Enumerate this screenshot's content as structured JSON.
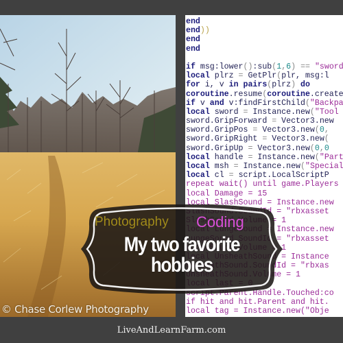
{
  "photo": {
    "subject": "dry golden grass field with bare winter trees under pale sky",
    "credit": "© Chase Corlew Photography"
  },
  "code": {
    "lines": [
      [
        [
          "k",
          "end"
        ]
      ],
      [
        [
          "k",
          "end"
        ],
        [
          "p",
          "))"
        ]
      ],
      [
        [
          "k",
          "end"
        ]
      ],
      [
        [
          "k",
          "end"
        ]
      ],
      [],
      [
        [
          "k",
          "if"
        ],
        [
          "i",
          " msg:lower"
        ],
        [
          "o",
          "()"
        ],
        [
          "i",
          ":sub"
        ],
        [
          "o",
          "("
        ],
        [
          "n",
          "1"
        ],
        [
          "o",
          ","
        ],
        [
          "n",
          "6"
        ],
        [
          "o",
          ")"
        ],
        [
          "o",
          " == "
        ],
        [
          "s",
          "\"sword"
        ]
      ],
      [
        [
          "k",
          "local"
        ],
        [
          "i",
          " plrz "
        ],
        [
          "o",
          "="
        ],
        [
          "i",
          " GetPlr"
        ],
        [
          "o",
          "("
        ],
        [
          "i",
          "plr, msg:l"
        ]
      ],
      [
        [
          "k",
          "for"
        ],
        [
          "i",
          " i, v "
        ],
        [
          "k",
          "in"
        ],
        [
          "k",
          " pairs"
        ],
        [
          "o",
          "("
        ],
        [
          "i",
          "plrz"
        ],
        [
          "o",
          ")"
        ],
        [
          "k",
          " do"
        ]
      ],
      [
        [
          "k",
          "coroutine"
        ],
        [
          "i",
          ".resume"
        ],
        [
          "o",
          "("
        ],
        [
          "k",
          "coroutine"
        ],
        [
          "i",
          ".create"
        ]
      ],
      [
        [
          "k",
          "if"
        ],
        [
          "i",
          " v "
        ],
        [
          "k",
          "and"
        ],
        [
          "i",
          " v:findFirstChild"
        ],
        [
          "o",
          "("
        ],
        [
          "s",
          "\"Backpack"
        ]
      ],
      [
        [
          "k",
          "local"
        ],
        [
          "i",
          " sword "
        ],
        [
          "o",
          "="
        ],
        [
          "i",
          " Instance.new"
        ],
        [
          "o",
          "("
        ],
        [
          "s",
          "\"Tool"
        ]
      ],
      [
        [
          "i",
          "sword.GripForward "
        ],
        [
          "o",
          "="
        ],
        [
          "i",
          " Vector3.new"
        ]
      ],
      [
        [
          "i",
          "sword.GripPos "
        ],
        [
          "o",
          "="
        ],
        [
          "i",
          " Vector3.new"
        ],
        [
          "o",
          "("
        ],
        [
          "n",
          "0"
        ],
        [
          "o",
          ","
        ]
      ],
      [
        [
          "i",
          "sword.GripRight "
        ],
        [
          "o",
          "="
        ],
        [
          "i",
          " Vector3.new"
        ],
        [
          "o",
          "("
        ]
      ],
      [
        [
          "i",
          "sword.GripUp "
        ],
        [
          "o",
          "="
        ],
        [
          "i",
          " Vector3.new"
        ],
        [
          "o",
          "("
        ],
        [
          "n",
          "0"
        ],
        [
          "o",
          ","
        ],
        [
          "n",
          "0"
        ]
      ],
      [
        [
          "k",
          "local"
        ],
        [
          "i",
          " handle "
        ],
        [
          "o",
          "="
        ],
        [
          "i",
          " Instance.new"
        ],
        [
          "o",
          "("
        ],
        [
          "s",
          "\"Part"
        ]
      ],
      [
        [
          "k",
          "local"
        ],
        [
          "i",
          " msh "
        ],
        [
          "o",
          "="
        ],
        [
          "i",
          " Instance.new"
        ],
        [
          "o",
          "("
        ],
        [
          "s",
          "\"SpecialMesh"
        ]
      ],
      [
        [
          "k",
          "local"
        ],
        [
          "i",
          " cl "
        ],
        [
          "o",
          "="
        ],
        [
          "i",
          " script.LocalScriptP"
        ]
      ],
      [
        [
          "s",
          "repeat wait() until game.Players"
        ]
      ],
      [
        [
          "s",
          "local Damage = 15"
        ]
      ],
      [
        [
          "s",
          "local SlashSound = Instance.new"
        ]
      ],
      [
        [
          "s",
          "SlashSound.SoundId = \"rbxasset"
        ]
      ],
      [
        [
          "s",
          "SlashSound.Volume = 1"
        ]
      ],
      [
        [
          "s",
          "local LungeSound = Instance.new"
        ]
      ],
      [
        [
          "s",
          "LungeSound.SoundId = \"rbxasset"
        ]
      ],
      [
        [
          "s",
          "LungeSound.Volume = 1"
        ]
      ],
      [
        [
          "s",
          "local UnsheathSound = Instance"
        ]
      ],
      [
        [
          "s",
          "UnsheathSound.SoundId = \"rbxas"
        ]
      ],
      [
        [
          "s",
          "UnsheathSound.Volume = 1"
        ]
      ],
      [
        [
          "s",
          "local last = 0"
        ]
      ],
      [
        [
          "s",
          "script.Parent.Handle.Touched:co"
        ]
      ],
      [
        [
          "s",
          "if hit and hit.Parent and hit."
        ]
      ],
      [
        [
          "s",
          "local tag = Instance.new(\"Obje"
        ]
      ]
    ]
  },
  "badge": {
    "left_label": "Photography",
    "right_label": "Coding",
    "title_line1": "My two favorite",
    "title_line2": "hobbies"
  },
  "footer": {
    "site": "LiveAndLearnFarm.com"
  },
  "colors": {
    "frame": "#404040",
    "photography_label": "#a08a1a",
    "coding_label": "#d94fd8",
    "keyword": "#1a1a7a",
    "string": "#9b2b98",
    "number": "#1b8a8a"
  }
}
